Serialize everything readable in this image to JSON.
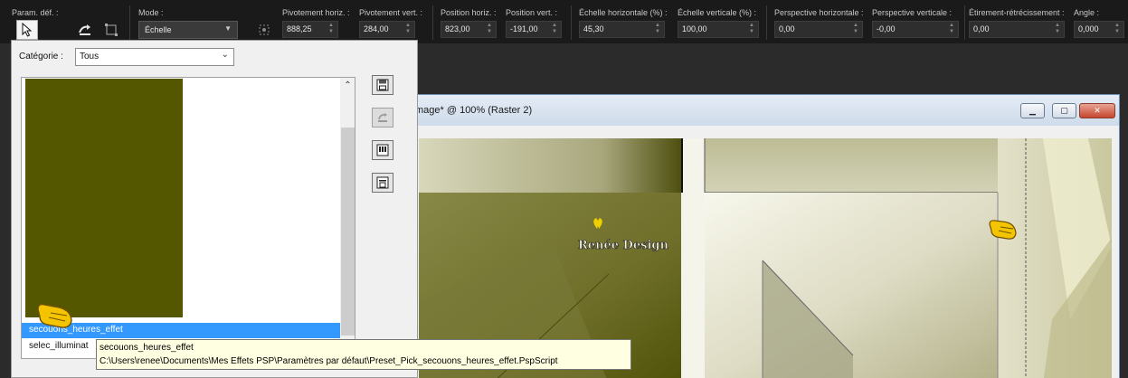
{
  "toolbar": {
    "preset_label": "Param. déf. :",
    "mode_label": "Mode :",
    "mode_value": "Échelle",
    "fields": [
      {
        "label": "Pivotement horiz. :",
        "value": "888,25"
      },
      {
        "label": "Pivotement vert. :",
        "value": "284,00"
      },
      {
        "label": "Position horiz. :",
        "value": "823,00"
      },
      {
        "label": "Position vert. :",
        "value": "-191,00"
      },
      {
        "label": "Échelle horizontale (%) :",
        "value": "45,30"
      },
      {
        "label": "Échelle verticale (%) :",
        "value": "100,00"
      },
      {
        "label": "Perspective horizontale :",
        "value": "0,00"
      },
      {
        "label": "Perspective verticale :",
        "value": "-0,00"
      },
      {
        "label": "Étirement-rétrécissement :",
        "value": "0,00"
      },
      {
        "label": "Angle :",
        "value": "0,000"
      }
    ]
  },
  "image_window": {
    "title": "mage* @ 100% (Raster 2)",
    "watermark": "Renée Design"
  },
  "dialog": {
    "category_label": "Catégorie :",
    "category_value": "Tous",
    "items": [
      {
        "label": "secouons_heures_effet",
        "selected": true
      },
      {
        "label": "selec_illuminat",
        "selected": false
      }
    ]
  },
  "tooltip": {
    "title": "secouons_heures_effet",
    "path": "C:\\Users\\renee\\Documents\\Mes Effets PSP\\Paramètres par défaut\\Preset_Pick_secouons_heures_effet.PspScript"
  },
  "colors": {
    "thumbnail": "#545700",
    "selection": "#3399ff",
    "toolbar_bg": "#1a1a1a"
  },
  "icons": [
    "pointer-tool-icon",
    "pick-tool-icon",
    "scale-tool-icon",
    "pivot-icon",
    "save-preset-icon",
    "reset-preset-icon",
    "load-preset-icon",
    "delete-preset-icon",
    "hand-pointer-icon"
  ]
}
